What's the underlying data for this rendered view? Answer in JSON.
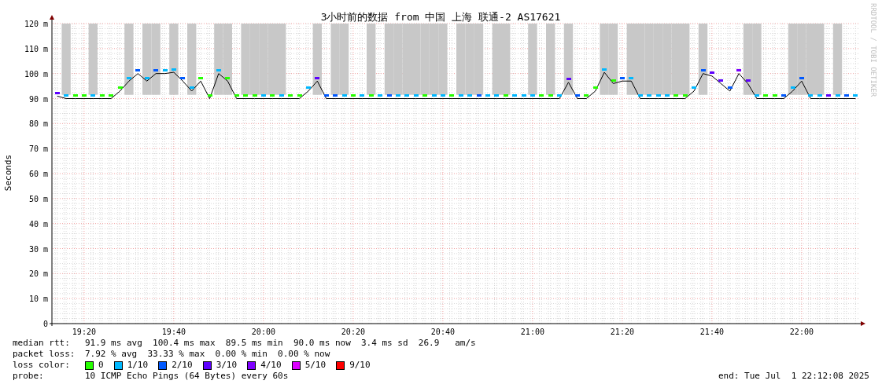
{
  "chart": {
    "chart_data": {
      "type": "line",
      "title": "3小时前的数据 from 中国 上海 联通-2 AS17621",
      "ylabel": "Seconds",
      "categories": [
        null,
        null,
        null,
        "19:20",
        null,
        null,
        null,
        null,
        null,
        null,
        null,
        null,
        null,
        "19:40",
        null,
        null,
        null,
        null,
        null,
        null,
        null,
        null,
        null,
        "20:00",
        null,
        null,
        null,
        null,
        null,
        null,
        null,
        null,
        null,
        "20:20",
        null,
        null,
        null,
        null,
        null,
        null,
        null,
        null,
        null,
        "20:40",
        null,
        null,
        null,
        null,
        null,
        null,
        null,
        null,
        null,
        "21:00",
        null,
        null,
        null,
        null,
        null,
        null,
        null,
        null,
        null,
        "21:20",
        null,
        null,
        null,
        null,
        null,
        null,
        null,
        null,
        null,
        "21:40",
        null,
        null,
        null,
        null,
        null,
        null,
        null,
        null,
        null,
        "22:00",
        null,
        null,
        null,
        null,
        null,
        null
      ],
      "series": [
        {
          "color": "#000000",
          "values": [
            91,
            90,
            90,
            90,
            90,
            90,
            90,
            93,
            97,
            100,
            97,
            100,
            100,
            100.5,
            97,
            93,
            97,
            90,
            100,
            97,
            90,
            90,
            90,
            90,
            90,
            90,
            90,
            90,
            93,
            97,
            90,
            90,
            90,
            90,
            90,
            90,
            90,
            90,
            90,
            90,
            90,
            90,
            90,
            90,
            90,
            90,
            90,
            90,
            90,
            90,
            90,
            90,
            90,
            90,
            90,
            90,
            90,
            96.5,
            90,
            90,
            93,
            100.5,
            96,
            97,
            97,
            90,
            90,
            90,
            90,
            90,
            90,
            93,
            100,
            99,
            96,
            93,
            100,
            96,
            90,
            90,
            90,
            90,
            93,
            97,
            90,
            90,
            90,
            90,
            90,
            90
          ]
        }
      ],
      "ylim": [
        0,
        120
      ],
      "grid": true,
      "yticks": [
        {
          "value": 0,
          "label": "0"
        },
        {
          "value": 10,
          "label": "10 m"
        },
        {
          "value": 20,
          "label": "20 m"
        },
        {
          "value": 30,
          "label": "30 m"
        },
        {
          "value": 40,
          "label": "40 m"
        },
        {
          "value": 50,
          "label": "50 m"
        },
        {
          "value": 60,
          "label": "60 m"
        },
        {
          "value": 70,
          "label": "70 m"
        },
        {
          "value": 80,
          "label": "80 m"
        },
        {
          "value": 90,
          "label": "90 m"
        },
        {
          "value": 100,
          "label": "100 m"
        },
        {
          "value": 110,
          "label": "110 m"
        },
        {
          "value": 120,
          "label": "120 m"
        }
      ]
    },
    "loss_markers": [
      {
        "color": "#5e00ff"
      },
      {
        "color": "#00b8ff"
      },
      {
        "color": "#26ff00"
      },
      {
        "color": "#26ff00"
      },
      {
        "color": "#00b8ff"
      },
      {
        "color": "#26ff00"
      },
      {
        "color": "#26ff00"
      },
      {
        "color": "#26ff00"
      },
      {
        "color": "#00b8ff"
      },
      {
        "color": "#0059ff"
      },
      {
        "color": "#00b8ff"
      },
      {
        "color": "#0059ff"
      },
      {
        "color": "#00b8ff"
      },
      {
        "color": "#00b8ff"
      },
      {
        "color": "#0059ff"
      },
      {
        "color": "#00b8ff"
      },
      {
        "color": "#26ff00"
      },
      {
        "color": "#26ff00"
      },
      {
        "color": "#00b8ff"
      },
      {
        "color": "#26ff00"
      },
      {
        "color": "#26ff00"
      },
      {
        "color": "#26ff00"
      },
      {
        "color": "#26ff00"
      },
      {
        "color": "#00b8ff"
      },
      {
        "color": "#26ff00"
      },
      {
        "color": "#00b8ff"
      },
      {
        "color": "#26ff00"
      },
      {
        "color": "#26ff00"
      },
      {
        "color": "#00b8ff"
      },
      {
        "color": "#5e00ff"
      },
      {
        "color": "#0059ff"
      },
      {
        "color": "#0059ff"
      },
      {
        "color": "#00b8ff"
      },
      {
        "color": "#26ff00"
      },
      {
        "color": "#00b8ff"
      },
      {
        "color": "#26ff00"
      },
      {
        "color": "#00b8ff"
      },
      {
        "color": "#0059ff"
      },
      {
        "color": "#00b8ff"
      },
      {
        "color": "#00b8ff"
      },
      {
        "color": "#00b8ff"
      },
      {
        "color": "#26ff00"
      },
      {
        "color": "#00b8ff"
      },
      {
        "color": "#00b8ff"
      },
      {
        "color": "#26ff00"
      },
      {
        "color": "#00b8ff"
      },
      {
        "color": "#00b8ff"
      },
      {
        "color": "#0059ff"
      },
      {
        "color": "#00b8ff"
      },
      {
        "color": "#00b8ff"
      },
      {
        "color": "#26ff00"
      },
      {
        "color": "#00b8ff"
      },
      {
        "color": "#00b8ff"
      },
      {
        "color": "#00b8ff"
      },
      {
        "color": "#26ff00"
      },
      {
        "color": "#26ff00"
      },
      {
        "color": "#00b8ff"
      },
      {
        "color": "#5e00ff"
      },
      {
        "color": "#0059ff"
      },
      {
        "color": "#26ff00"
      },
      {
        "color": "#26ff00"
      },
      {
        "color": "#00b8ff"
      },
      {
        "color": "#26ff00"
      },
      {
        "color": "#0059ff"
      },
      {
        "color": "#00b8ff"
      },
      {
        "color": "#00b8ff"
      },
      {
        "color": "#00b8ff"
      },
      {
        "color": "#00b8ff"
      },
      {
        "color": "#00b8ff"
      },
      {
        "color": "#26ff00"
      },
      {
        "color": "#26ff00"
      },
      {
        "color": "#00b8ff"
      },
      {
        "color": "#0059ff"
      },
      {
        "color": "#5e00ff"
      },
      {
        "color": "#5e00ff"
      },
      {
        "color": "#0059ff"
      },
      {
        "color": "#7e00ff"
      },
      {
        "color": "#5e00ff"
      },
      {
        "color": "#00b8ff"
      },
      {
        "color": "#26ff00"
      },
      {
        "color": "#26ff00"
      },
      {
        "color": "#0059ff"
      },
      {
        "color": "#00b8ff"
      },
      {
        "color": "#0059ff"
      },
      {
        "color": "#00b8ff"
      },
      {
        "color": "#00b8ff"
      },
      {
        "color": "#5e00ff"
      },
      {
        "color": "#00b8ff"
      },
      {
        "color": "#0059ff"
      },
      {
        "color": "#00b8ff"
      }
    ]
  },
  "vertical_credit": "RRDTOOL / TOBI OETIKER",
  "legend": {
    "median_rtt": {
      "label": "median rtt:",
      "text": "91.9 ms avg  100.4 ms max  89.5 ms min  90.0 ms now  3.4 ms sd  26.9   am/s"
    },
    "packet_loss": {
      "label": "packet loss:",
      "text": "7.92 % avg  33.33 % max  0.00 % min  0.00 % now"
    },
    "loss_color": {
      "label": "loss color:",
      "items": [
        {
          "label": "0",
          "color": "#26ff00"
        },
        {
          "label": "1/10",
          "color": "#00b8ff"
        },
        {
          "label": "2/10",
          "color": "#0059ff"
        },
        {
          "label": "3/10",
          "color": "#5e00ff"
        },
        {
          "label": "4/10",
          "color": "#7e00ff"
        },
        {
          "label": "5/10",
          "color": "#dd00ff"
        },
        {
          "label": "9/10",
          "color": "#ff0000"
        }
      ]
    },
    "probe": {
      "label": "probe:",
      "text": "10 ICMP Echo Pings (64 Bytes) every 60s"
    },
    "end": "end: Tue Jul  1 22:12:08 2025"
  }
}
